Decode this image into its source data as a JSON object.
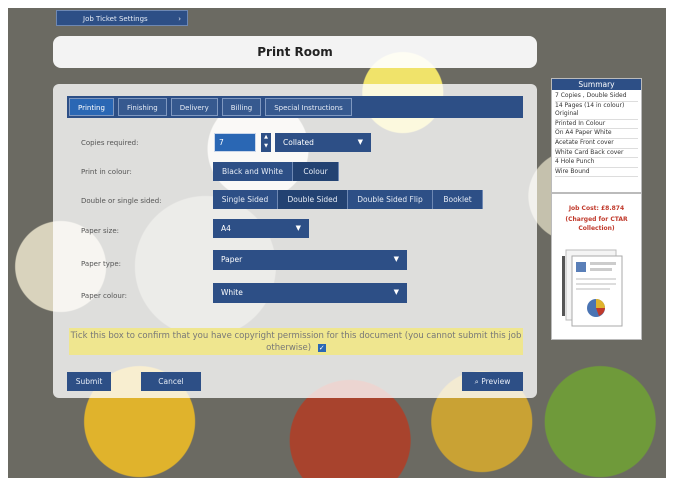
{
  "top_tab": {
    "label": "Job Ticket Settings",
    "chevron": "›"
  },
  "title": "Print Room",
  "tabs": [
    {
      "label": "Printing",
      "active": true
    },
    {
      "label": "Finishing",
      "active": false
    },
    {
      "label": "Delivery",
      "active": false
    },
    {
      "label": "Billing",
      "active": false
    },
    {
      "label": "Special Instructions",
      "active": false
    }
  ],
  "form": {
    "copies": {
      "label": "Copies required:",
      "value": "7",
      "collation": "Collated"
    },
    "colour": {
      "label": "Print in colour:",
      "options": [
        "Black and White",
        "Colour"
      ],
      "selected": "Colour"
    },
    "sides": {
      "label": "Double or single sided:",
      "options": [
        "Single Sided",
        "Double Sided",
        "Double Sided Flip",
        "Booklet"
      ],
      "selected": "Double Sided"
    },
    "size": {
      "label": "Paper size:",
      "value": "A4"
    },
    "type": {
      "label": "Paper type:",
      "value": "Paper"
    },
    "paper_colour": {
      "label": "Paper colour:",
      "value": "White"
    }
  },
  "confirm": {
    "text": "Tick this box to confirm that you have copyright permission for this document (you cannot submit this job otherwise)",
    "checked": true
  },
  "buttons": {
    "submit": "Submit",
    "cancel": "Cancel",
    "preview": "Preview"
  },
  "summary": {
    "title": "Summary",
    "items": [
      "7 Copies , Double Sided",
      "14 Pages (14 in colour) Original",
      "Printed In Colour",
      "On A4 Paper White",
      "Acetate Front cover",
      "White Card Back cover",
      "4 Hole Punch",
      "Wire Bound"
    ],
    "cost": "Job Cost: £8.874",
    "charge_note": "(Charged for CTAR Collection)"
  },
  "colors": {
    "primary": "#2d4f86",
    "accent": "#2a67b4",
    "warning_bg": "#efe68f",
    "cost_text": "#c0392b"
  }
}
